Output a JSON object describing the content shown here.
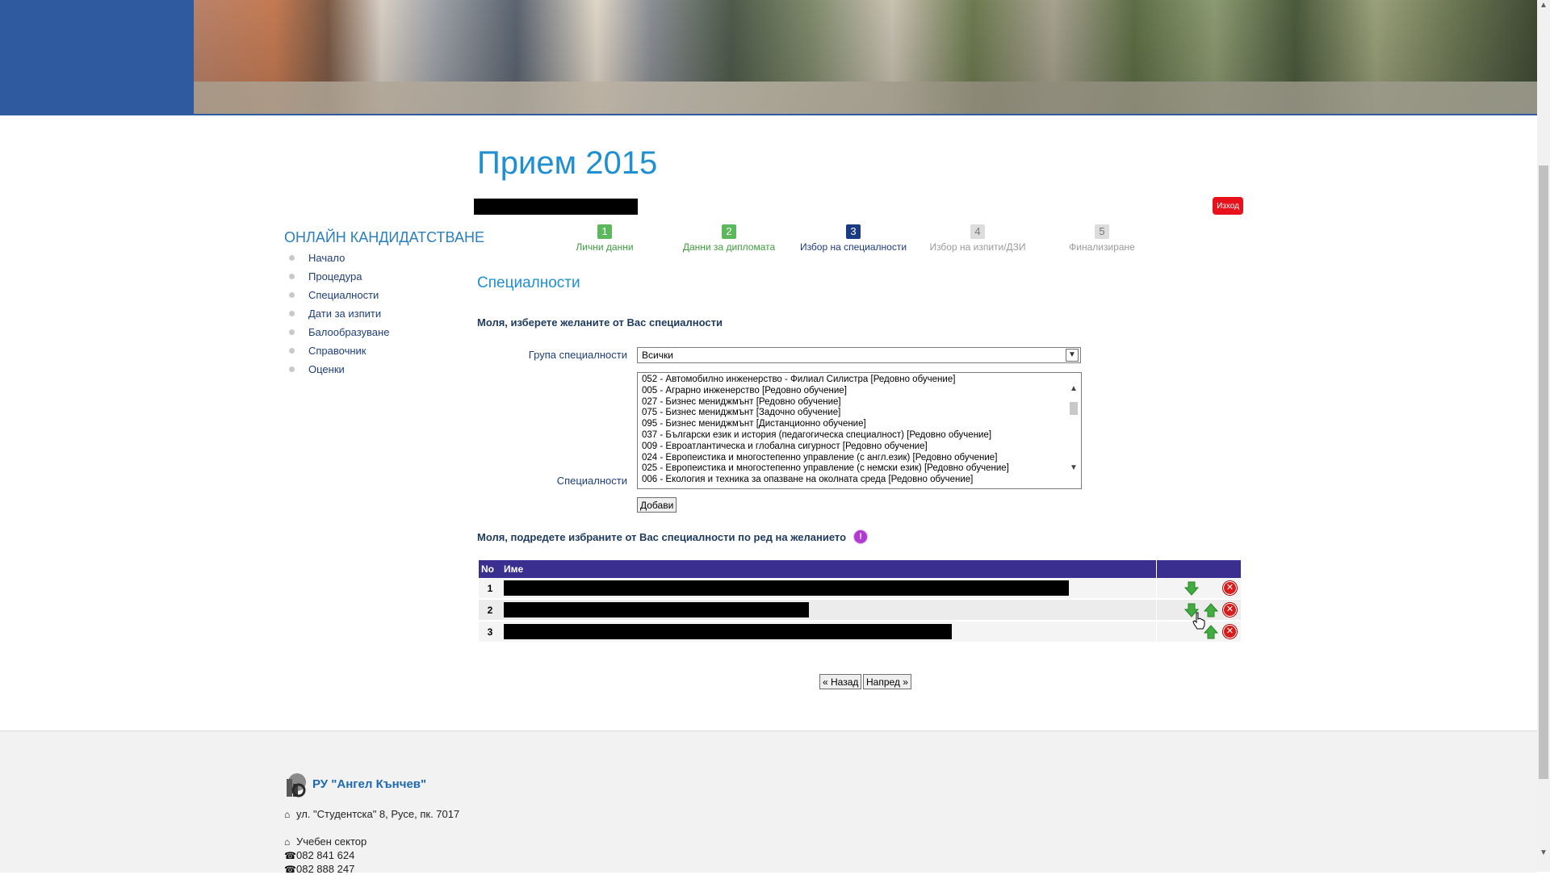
{
  "sidebar": {
    "title": "ОНЛАЙН КАНДИДАТСТВАНЕ",
    "items": [
      "Начало",
      "Процедура",
      "Специалности",
      "Дати за изпити",
      "Балообразуване",
      "Справочник",
      "Оценки"
    ]
  },
  "header": {
    "page_title": "Прием 2015",
    "logout_label": "Изход"
  },
  "steps": [
    {
      "num": "1",
      "label": "Лични данни",
      "state": "done"
    },
    {
      "num": "2",
      "label": "Данни за дипломата",
      "state": "done"
    },
    {
      "num": "3",
      "label": "Избор на специалности",
      "state": "active"
    },
    {
      "num": "4",
      "label": "Избор на изпити/ДЗИ",
      "state": "todo"
    },
    {
      "num": "5",
      "label": "Финализиране",
      "state": "todo"
    }
  ],
  "main": {
    "section_title": "Специалности",
    "instruction": "Моля, изберете желаните от Вас специалности",
    "group_label": "Група специалности",
    "group_value": "Всички",
    "spec_label": "Специалности",
    "spec_options": [
      "052 - Автомобилно инженерство - Филиал Силистра [Редовно обучение]",
      "005 - Аграрно инженерство [Редовно обучение]",
      "027 - Бизнес мениджмънт [Редовно обучение]",
      "075 - Бизнес мениджмънт [Задочно обучение]",
      "095 - Бизнес мениджмънт [Дистанционно обучение]",
      "037 - Български език и история (педагогическа специалност) [Редовно обучение]",
      "009 - Евроатлантическа и глобална сигурност [Редовно обучение]",
      "024 - Европеистика и многостепенно управление (с англ.език) [Редовно обучение]",
      "025 - Европеистика и многостепенно управление (с немски език) [Редовно обучение]",
      "006 - Екология и техника за опазване на околната среда [Редовно обучение]"
    ],
    "add_label": "Добави",
    "order_instruction": "Моля, подредете избраните от Вас специалности по ред на желанието",
    "info_icon_glyph": "!"
  },
  "table": {
    "headers": [
      "No",
      "Име",
      ""
    ],
    "rows": [
      {
        "no": "1",
        "redacted_fraction": 0.87
      },
      {
        "no": "2",
        "redacted_fraction": 0.47
      },
      {
        "no": "3",
        "redacted_fraction": 0.69
      }
    ]
  },
  "nav": {
    "back_label": "« Назад",
    "next_label": "Напред »"
  },
  "footer": {
    "org_name": "РУ \"Ангел Кънчев\"",
    "address": "ул. \"Студентска\" 8, Русе, пк. 7017",
    "dept": "Учебен сектор",
    "phone1": "082 841 624",
    "phone2": "082 888 247"
  },
  "colors": {
    "banner_blue": "#2f5aa0",
    "accent": "#1e8fd0",
    "table_header": "#3a2f8f",
    "step_done": "#5cb85c",
    "step_active": "#1b3a84",
    "logout": "#e8101a"
  },
  "icons": {
    "move_down": "arrow-down-icon",
    "move_up": "arrow-up-icon",
    "delete": "delete-icon",
    "home": "home-icon",
    "phone": "phone-icon"
  }
}
